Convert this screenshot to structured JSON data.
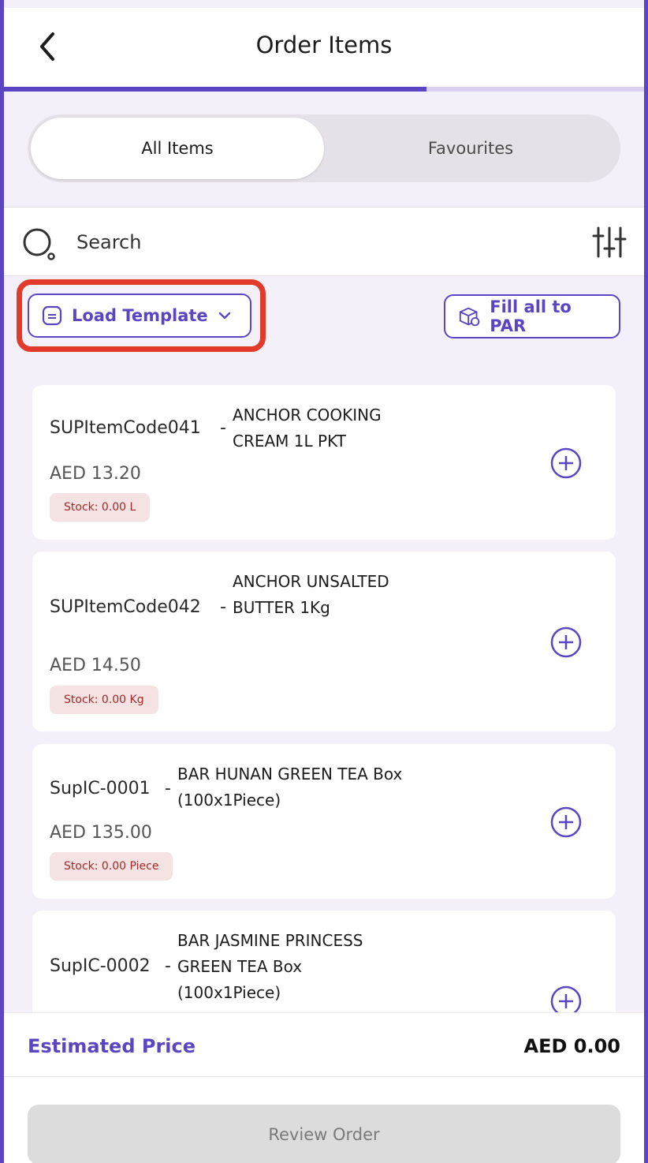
{
  "header": {
    "title": "Order Items",
    "progress_percent": 66
  },
  "tabs": [
    {
      "label": "All Items",
      "active": true
    },
    {
      "label": "Favourites",
      "active": false
    }
  ],
  "search": {
    "placeholder": "Search"
  },
  "actions": {
    "load_template": "Load Template",
    "fill_par": "Fill all to PAR"
  },
  "items": [
    {
      "code": "SUPItemCode041",
      "name": "ANCHOR COOKING CREAM 1L PKT",
      "price": "AED 13.20",
      "stock": "Stock: 0.00 L"
    },
    {
      "code": "SUPItemCode042",
      "name": "ANCHOR UNSALTED BUTTER 1Kg",
      "price": "AED 14.50",
      "stock": "Stock: 0.00 Kg"
    },
    {
      "code": "SupIC-0001",
      "name": "BAR HUNAN GREEN TEA Box (100x1Piece)",
      "price": "AED 135.00",
      "stock": "Stock: 0.00 Piece"
    },
    {
      "code": "SupIC-0002",
      "name": "BAR JASMINE PRINCESS GREEN TEA Box (100x1Piece)"
    }
  ],
  "footer": {
    "estimated_label": "Estimated Price",
    "estimated_value": "AED 0.00",
    "review_label": "Review Order"
  },
  "colors": {
    "primary": "#5b45c2",
    "highlight": "#e23a2b",
    "stock_bg": "#f5e2e2",
    "stock_text": "#a02a2a"
  }
}
